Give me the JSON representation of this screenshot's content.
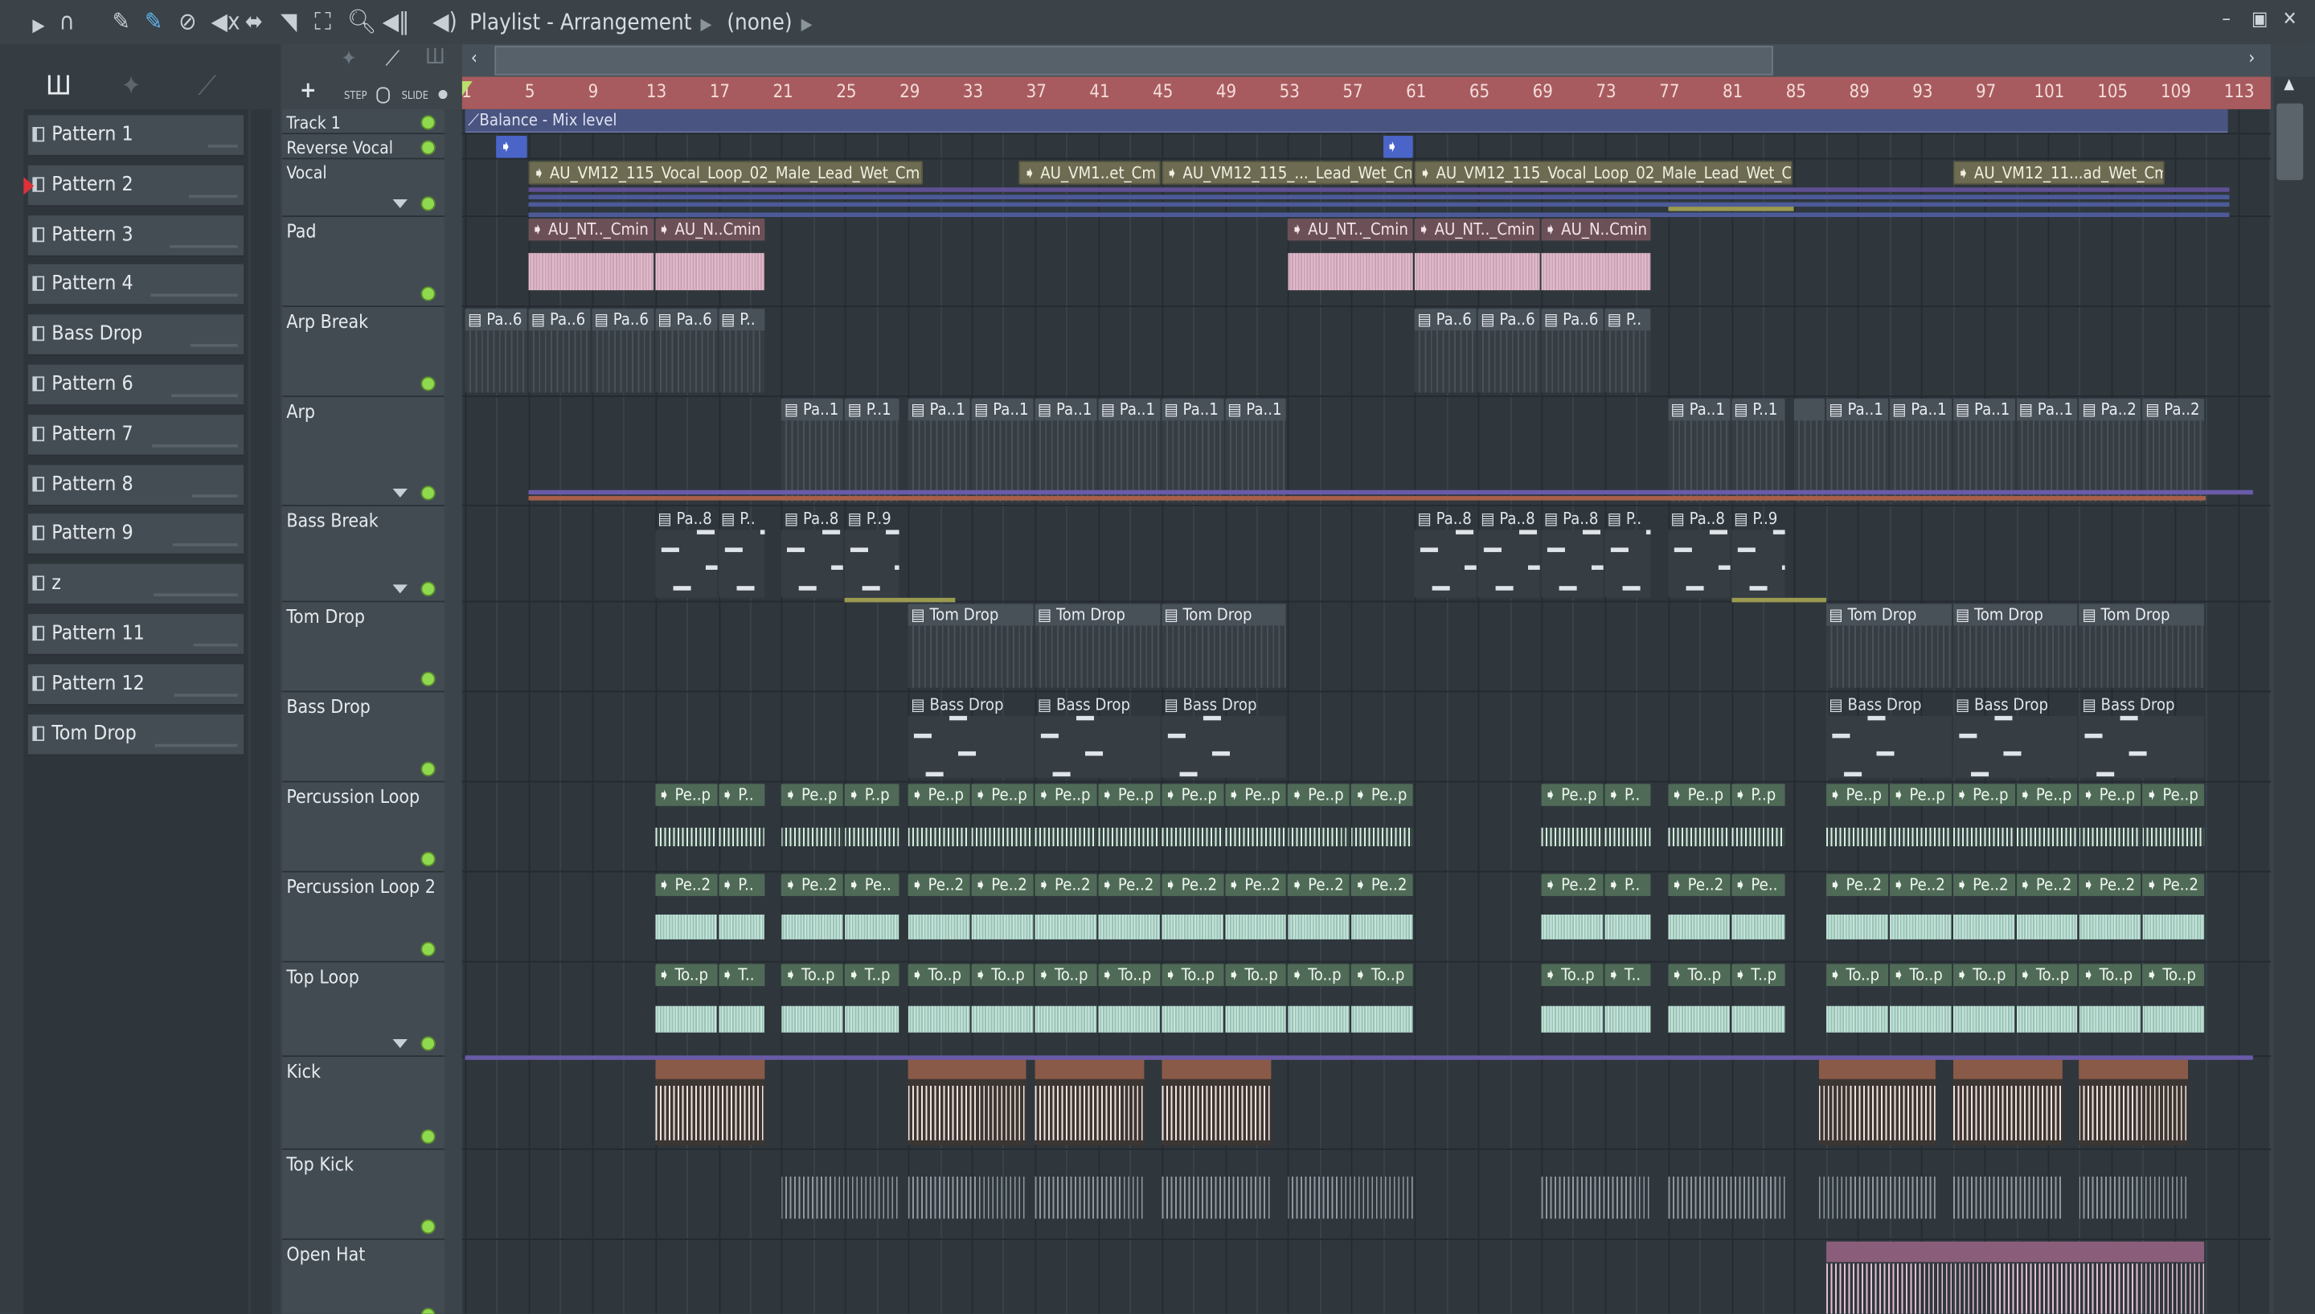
{
  "window": {
    "title": "Playlist - Arrangement",
    "pattern_selector": "(none)",
    "controls": [
      "minimize",
      "maximize",
      "close"
    ]
  },
  "toolbar": {
    "icons": [
      "play-arrow-icon",
      "magnet-icon",
      "pencil-icon",
      "paint-brush-icon",
      "delete-icon",
      "mute-icon",
      "slip-icon",
      "slice-icon",
      "select-icon",
      "zoom-icon",
      "playback-icon",
      "speaker-icon"
    ],
    "step_label": "STEP",
    "slide_label": "SLIDE",
    "add_label": "+"
  },
  "left_panel": {
    "patterns": [
      "Pattern 1",
      "Pattern 2",
      "Pattern 3",
      "Pattern 4",
      "Bass Drop",
      "Pattern 6",
      "Pattern 7",
      "Pattern 8",
      "Pattern 9",
      "z",
      "Pattern 11",
      "Pattern 12",
      "Tom Drop"
    ],
    "selected": "Pattern 2"
  },
  "ruler": {
    "labels": [
      "1",
      "5",
      "9",
      "13",
      "17",
      "21",
      "25",
      "29",
      "33",
      "37",
      "41",
      "45",
      "49",
      "53",
      "57",
      "61",
      "65",
      "69",
      "73",
      "77",
      "81",
      "85",
      "89",
      "93",
      "97",
      "101",
      "105",
      "109",
      "113"
    ]
  },
  "tracks": [
    {
      "name": "Track 1",
      "h": 17,
      "small": true,
      "clips": [
        {
          "s": 1,
          "e": 112.5,
          "k": "auto",
          "t": "Balance - Mix level"
        }
      ]
    },
    {
      "name": "Reverse Vocal",
      "h": 17,
      "small": true,
      "clips": [
        {
          "s": 3,
          "e": 5,
          "k": "rev",
          "t": "➧"
        },
        {
          "s": 59,
          "e": 61,
          "k": "rev",
          "t": "➧"
        }
      ]
    },
    {
      "name": "Vocal",
      "h": 39,
      "small": true,
      "arrow": true,
      "clips": [
        {
          "s": 5,
          "e": 30,
          "k": "vocal",
          "t": "AU_VM12_115_Vocal_Loop_02_Male_Lead_Wet_Cm"
        },
        {
          "s": 36,
          "e": 45,
          "k": "vocal",
          "t": "AU_VM1..et_Cm"
        },
        {
          "s": 45,
          "e": 61,
          "k": "vocal",
          "t": "AU_VM12_115_..._Lead_Wet_Cm"
        },
        {
          "s": 61,
          "e": 85,
          "k": "vocal",
          "t": "AU_VM12_115_Vocal_Loop_02_Male_Lead_Wet_Cm"
        },
        {
          "s": 95,
          "e": 108.5,
          "k": "vocal",
          "t": "AU_VM12_11...ad_Wet_Cm"
        }
      ]
    },
    {
      "name": "Pad",
      "h": 61,
      "clips": [
        {
          "s": 5,
          "e": 13,
          "k": "pad",
          "t": "AU_NT.._Cmin"
        },
        {
          "s": 13,
          "e": 20,
          "k": "pad",
          "t": "AU_N..Cmin"
        },
        {
          "s": 53,
          "e": 61,
          "k": "pad",
          "t": "AU_NT.._Cmin"
        },
        {
          "s": 61,
          "e": 69,
          "k": "pad",
          "t": "AU_NT.._Cmin"
        },
        {
          "s": 69,
          "e": 76,
          "k": "pad",
          "t": "AU_N..Cmin"
        }
      ]
    },
    {
      "name": "Arp Break",
      "h": 61,
      "clips": [
        {
          "s": 1,
          "e": 5,
          "k": "pat",
          "t": "Pa..6"
        },
        {
          "s": 5,
          "e": 9,
          "k": "pat",
          "t": "Pa..6"
        },
        {
          "s": 9,
          "e": 13,
          "k": "pat",
          "t": "Pa..6"
        },
        {
          "s": 13,
          "e": 17,
          "k": "pat",
          "t": "Pa..6"
        },
        {
          "s": 17,
          "e": 20,
          "k": "pat",
          "t": "P.."
        },
        {
          "s": 61,
          "e": 65,
          "k": "pat",
          "t": "Pa..6"
        },
        {
          "s": 65,
          "e": 69,
          "k": "pat",
          "t": "Pa..6"
        },
        {
          "s": 69,
          "e": 73,
          "k": "pat",
          "t": "Pa..6"
        },
        {
          "s": 73,
          "e": 76,
          "k": "pat",
          "t": "P.."
        }
      ]
    },
    {
      "name": "Arp",
      "h": 74,
      "arrow": true,
      "clips": [
        {
          "s": 21,
          "e": 25,
          "k": "pat",
          "t": "Pa..1"
        },
        {
          "s": 25,
          "e": 28.5,
          "k": "pat",
          "t": "P..1"
        },
        {
          "s": 29,
          "e": 33,
          "k": "pat",
          "t": "Pa..1"
        },
        {
          "s": 33,
          "e": 37,
          "k": "pat",
          "t": "Pa..1"
        },
        {
          "s": 37,
          "e": 41,
          "k": "pat",
          "t": "Pa..1"
        },
        {
          "s": 41,
          "e": 45,
          "k": "pat",
          "t": "Pa..1"
        },
        {
          "s": 45,
          "e": 49,
          "k": "pat",
          "t": "Pa..1"
        },
        {
          "s": 49,
          "e": 53,
          "k": "pat",
          "t": "Pa..1"
        },
        {
          "s": 77,
          "e": 81,
          "k": "pat",
          "t": "Pa..1"
        },
        {
          "s": 81,
          "e": 84.5,
          "k": "pat",
          "t": "P..1"
        },
        {
          "s": 85,
          "e": 87,
          "k": "pat",
          "t": ""
        },
        {
          "s": 87,
          "e": 91,
          "k": "pat",
          "t": "Pa..1"
        },
        {
          "s": 91,
          "e": 95,
          "k": "pat",
          "t": "Pa..1"
        },
        {
          "s": 95,
          "e": 99,
          "k": "pat",
          "t": "Pa..1"
        },
        {
          "s": 99,
          "e": 103,
          "k": "pat",
          "t": "Pa..1"
        },
        {
          "s": 103,
          "e": 107,
          "k": "pat",
          "t": "Pa..2"
        },
        {
          "s": 107,
          "e": 111,
          "k": "pat",
          "t": "Pa..2"
        }
      ]
    },
    {
      "name": "Bass Break",
      "h": 65,
      "arrow": true,
      "clips": [
        {
          "s": 13,
          "e": 17,
          "k": "pnote",
          "t": "Pa..8"
        },
        {
          "s": 17,
          "e": 20,
          "k": "pnote",
          "t": "P.."
        },
        {
          "s": 21,
          "e": 25,
          "k": "pnote",
          "t": "Pa..8"
        },
        {
          "s": 25,
          "e": 28.5,
          "k": "pnote",
          "t": "P..9"
        },
        {
          "s": 61,
          "e": 65,
          "k": "pnote",
          "t": "Pa..8"
        },
        {
          "s": 65,
          "e": 69,
          "k": "pnote",
          "t": "Pa..8"
        },
        {
          "s": 69,
          "e": 73,
          "k": "pnote",
          "t": "Pa..8"
        },
        {
          "s": 73,
          "e": 76,
          "k": "pnote",
          "t": "P.."
        },
        {
          "s": 77,
          "e": 81,
          "k": "pnote",
          "t": "Pa..8"
        },
        {
          "s": 81,
          "e": 84.5,
          "k": "pnote",
          "t": "P..9"
        }
      ]
    },
    {
      "name": "Tom Drop",
      "h": 61,
      "clips": [
        {
          "s": 29,
          "e": 37,
          "k": "pat",
          "t": "Tom Drop"
        },
        {
          "s": 37,
          "e": 45,
          "k": "pat",
          "t": "Tom Drop"
        },
        {
          "s": 45,
          "e": 53,
          "k": "pat",
          "t": "Tom Drop"
        },
        {
          "s": 87,
          "e": 95,
          "k": "pat",
          "t": "Tom Drop"
        },
        {
          "s": 95,
          "e": 103,
          "k": "pat",
          "t": "Tom Drop"
        },
        {
          "s": 103,
          "e": 111,
          "k": "pat",
          "t": "Tom Drop"
        }
      ]
    },
    {
      "name": "Bass Drop",
      "h": 61,
      "clips": [
        {
          "s": 29,
          "e": 37,
          "k": "pnote",
          "t": "Bass Drop"
        },
        {
          "s": 37,
          "e": 45,
          "k": "pnote",
          "t": "Bass Drop"
        },
        {
          "s": 45,
          "e": 53,
          "k": "pnote",
          "t": "Bass Drop"
        },
        {
          "s": 87,
          "e": 95,
          "k": "pnote",
          "t": "Bass Drop"
        },
        {
          "s": 95,
          "e": 103,
          "k": "pnote",
          "t": "Bass Drop"
        },
        {
          "s": 103,
          "e": 111,
          "k": "pnote",
          "t": "Bass Drop"
        }
      ]
    },
    {
      "name": "Percussion Loop",
      "h": 61,
      "clips": [
        {
          "s": 13,
          "e": 17,
          "k": "perc",
          "t": "Pe..p"
        },
        {
          "s": 17,
          "e": 20,
          "k": "perc",
          "t": "P.."
        },
        {
          "s": 21,
          "e": 25,
          "k": "perc",
          "t": "Pe..p"
        },
        {
          "s": 25,
          "e": 28.5,
          "k": "perc",
          "t": "P..p"
        },
        {
          "s": 29,
          "e": 33,
          "k": "perc",
          "t": "Pe..p"
        },
        {
          "s": 33,
          "e": 37,
          "k": "perc",
          "t": "Pe..p"
        },
        {
          "s": 37,
          "e": 41,
          "k": "perc",
          "t": "Pe..p"
        },
        {
          "s": 41,
          "e": 45,
          "k": "perc",
          "t": "Pe..p"
        },
        {
          "s": 45,
          "e": 49,
          "k": "perc",
          "t": "Pe..p"
        },
        {
          "s": 49,
          "e": 53,
          "k": "perc",
          "t": "Pe..p"
        },
        {
          "s": 53,
          "e": 57,
          "k": "perc",
          "t": "Pe..p"
        },
        {
          "s": 57,
          "e": 61,
          "k": "perc",
          "t": "Pe..p"
        },
        {
          "s": 69,
          "e": 73,
          "k": "perc",
          "t": "Pe..p"
        },
        {
          "s": 73,
          "e": 76,
          "k": "perc",
          "t": "P.."
        },
        {
          "s": 77,
          "e": 81,
          "k": "perc",
          "t": "Pe..p"
        },
        {
          "s": 81,
          "e": 84.5,
          "k": "perc",
          "t": "P..p"
        },
        {
          "s": 87,
          "e": 91,
          "k": "perc",
          "t": "Pe..p"
        },
        {
          "s": 91,
          "e": 95,
          "k": "perc",
          "t": "Pe..p"
        },
        {
          "s": 95,
          "e": 99,
          "k": "perc",
          "t": "Pe..p"
        },
        {
          "s": 99,
          "e": 103,
          "k": "perc",
          "t": "Pe..p"
        },
        {
          "s": 103,
          "e": 107,
          "k": "perc",
          "t": "Pe..p"
        },
        {
          "s": 107,
          "e": 111,
          "k": "perc",
          "t": "Pe..p"
        }
      ]
    },
    {
      "name": "Percussion Loop 2",
      "h": 61,
      "clips": [
        {
          "s": 13,
          "e": 17,
          "k": "perc2",
          "t": "Pe..2"
        },
        {
          "s": 17,
          "e": 20,
          "k": "perc2",
          "t": "P.."
        },
        {
          "s": 21,
          "e": 25,
          "k": "perc2",
          "t": "Pe..2"
        },
        {
          "s": 25,
          "e": 28.5,
          "k": "perc2",
          "t": "Pe.."
        },
        {
          "s": 29,
          "e": 33,
          "k": "perc2",
          "t": "Pe..2"
        },
        {
          "s": 33,
          "e": 37,
          "k": "perc2",
          "t": "Pe..2"
        },
        {
          "s": 37,
          "e": 41,
          "k": "perc2",
          "t": "Pe..2"
        },
        {
          "s": 41,
          "e": 45,
          "k": "perc2",
          "t": "Pe..2"
        },
        {
          "s": 45,
          "e": 49,
          "k": "perc2",
          "t": "Pe..2"
        },
        {
          "s": 49,
          "e": 53,
          "k": "perc2",
          "t": "Pe..2"
        },
        {
          "s": 53,
          "e": 57,
          "k": "perc2",
          "t": "Pe..2"
        },
        {
          "s": 57,
          "e": 61,
          "k": "perc2",
          "t": "Pe..2"
        },
        {
          "s": 69,
          "e": 73,
          "k": "perc2",
          "t": "Pe..2"
        },
        {
          "s": 73,
          "e": 76,
          "k": "perc2",
          "t": "P.."
        },
        {
          "s": 77,
          "e": 81,
          "k": "perc2",
          "t": "Pe..2"
        },
        {
          "s": 81,
          "e": 84.5,
          "k": "perc2",
          "t": "Pe.."
        },
        {
          "s": 87,
          "e": 91,
          "k": "perc2",
          "t": "Pe..2"
        },
        {
          "s": 91,
          "e": 95,
          "k": "perc2",
          "t": "Pe..2"
        },
        {
          "s": 95,
          "e": 99,
          "k": "perc2",
          "t": "Pe..2"
        },
        {
          "s": 99,
          "e": 103,
          "k": "perc2",
          "t": "Pe..2"
        },
        {
          "s": 103,
          "e": 107,
          "k": "perc2",
          "t": "Pe..2"
        },
        {
          "s": 107,
          "e": 111,
          "k": "perc2",
          "t": "Pe..2"
        }
      ]
    },
    {
      "name": "Top Loop",
      "h": 64,
      "arrow": true,
      "clips": [
        {
          "s": 13,
          "e": 17,
          "k": "perc2",
          "t": "To..p"
        },
        {
          "s": 17,
          "e": 20,
          "k": "perc2",
          "t": "T.."
        },
        {
          "s": 21,
          "e": 25,
          "k": "perc2",
          "t": "To..p"
        },
        {
          "s": 25,
          "e": 28.5,
          "k": "perc2",
          "t": "T..p"
        },
        {
          "s": 29,
          "e": 33,
          "k": "perc2",
          "t": "To..p"
        },
        {
          "s": 33,
          "e": 37,
          "k": "perc2",
          "t": "To..p"
        },
        {
          "s": 37,
          "e": 41,
          "k": "perc2",
          "t": "To..p"
        },
        {
          "s": 41,
          "e": 45,
          "k": "perc2",
          "t": "To..p"
        },
        {
          "s": 45,
          "e": 49,
          "k": "perc2",
          "t": "To..p"
        },
        {
          "s": 49,
          "e": 53,
          "k": "perc2",
          "t": "To..p"
        },
        {
          "s": 53,
          "e": 57,
          "k": "perc2",
          "t": "To..p"
        },
        {
          "s": 57,
          "e": 61,
          "k": "perc2",
          "t": "To..p"
        },
        {
          "s": 69,
          "e": 73,
          "k": "perc2",
          "t": "To..p"
        },
        {
          "s": 73,
          "e": 76,
          "k": "perc2",
          "t": "T.."
        },
        {
          "s": 77,
          "e": 81,
          "k": "perc2",
          "t": "To..p"
        },
        {
          "s": 81,
          "e": 84.5,
          "k": "perc2",
          "t": "T..p"
        },
        {
          "s": 87,
          "e": 91,
          "k": "perc2",
          "t": "To..p"
        },
        {
          "s": 91,
          "e": 95,
          "k": "perc2",
          "t": "To..p"
        },
        {
          "s": 95,
          "e": 99,
          "k": "perc2",
          "t": "To..p"
        },
        {
          "s": 99,
          "e": 103,
          "k": "perc2",
          "t": "To..p"
        },
        {
          "s": 103,
          "e": 107,
          "k": "perc2",
          "t": "To..p"
        },
        {
          "s": 107,
          "e": 111,
          "k": "perc2",
          "t": "To..p"
        }
      ]
    },
    {
      "name": "Kick",
      "h": 63,
      "clips": [
        {
          "s": 13,
          "e": 20,
          "k": "kick",
          "t": ""
        },
        {
          "s": 29,
          "e": 36.5,
          "k": "kick",
          "t": ""
        },
        {
          "s": 37,
          "e": 44,
          "k": "kick",
          "t": ""
        },
        {
          "s": 45,
          "e": 52,
          "k": "kick",
          "t": ""
        },
        {
          "s": 86.5,
          "e": 94,
          "k": "kick",
          "t": ""
        },
        {
          "s": 95,
          "e": 102,
          "k": "kick",
          "t": ""
        },
        {
          "s": 103,
          "e": 110,
          "k": "kick",
          "t": ""
        }
      ]
    },
    {
      "name": "Top Kick",
      "h": 61,
      "clips": [
        {
          "s": 21,
          "e": 28.5,
          "k": "tk",
          "t": ""
        },
        {
          "s": 29,
          "e": 36.5,
          "k": "tk",
          "t": ""
        },
        {
          "s": 37,
          "e": 44,
          "k": "tk",
          "t": ""
        },
        {
          "s": 45,
          "e": 52,
          "k": "tk",
          "t": ""
        },
        {
          "s": 53,
          "e": 61,
          "k": "tk",
          "t": ""
        },
        {
          "s": 69,
          "e": 76,
          "k": "tk",
          "t": ""
        },
        {
          "s": 77,
          "e": 84.5,
          "k": "tk",
          "t": ""
        },
        {
          "s": 86.5,
          "e": 94,
          "k": "tk",
          "t": ""
        },
        {
          "s": 95,
          "e": 102,
          "k": "tk",
          "t": ""
        },
        {
          "s": 103,
          "e": 110,
          "k": "tk",
          "t": ""
        }
      ]
    },
    {
      "name": "Open Hat",
      "h": 60,
      "clips": [
        {
          "s": 87,
          "e": 111,
          "k": "oh",
          "t": ""
        }
      ]
    }
  ],
  "colors": {
    "ruler": "#a85b5e",
    "led": "#8fd94e",
    "automation": "#6a5ba8"
  }
}
